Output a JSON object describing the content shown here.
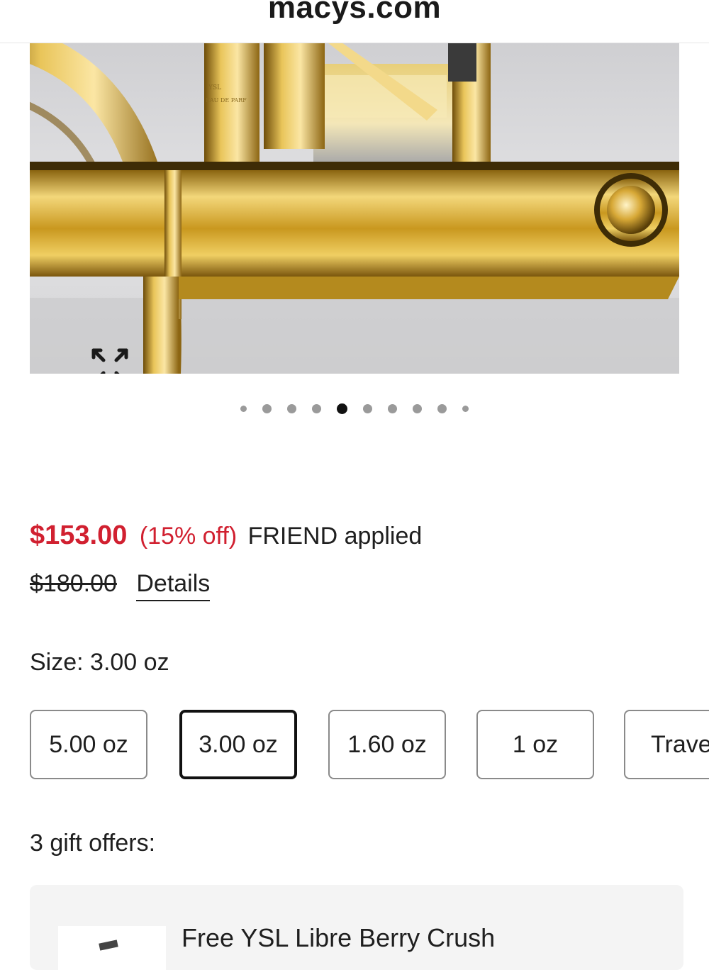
{
  "browser": {
    "url": "macys.com"
  },
  "gallery": {
    "expand_icon": "expand-arrows-icon",
    "dot_count": 10,
    "active_index": 4
  },
  "pricing": {
    "sale_price": "$153.00",
    "percent_off": "(15% off)",
    "promo_text": "FRIEND applied",
    "original_price": "$180.00",
    "details_label": "Details",
    "sale_color": "#d12030"
  },
  "size": {
    "label": "Size: 3.00 oz",
    "options": [
      {
        "label": "5.00 oz",
        "selected": false
      },
      {
        "label": "3.00 oz",
        "selected": true
      },
      {
        "label": "1.60 oz",
        "selected": false
      },
      {
        "label": "1 oz",
        "selected": false
      },
      {
        "label": "Trave",
        "selected": false
      }
    ]
  },
  "gifts": {
    "label": "3 gift offers:",
    "first_offer_title": "Free YSL Libre Berry Crush"
  }
}
